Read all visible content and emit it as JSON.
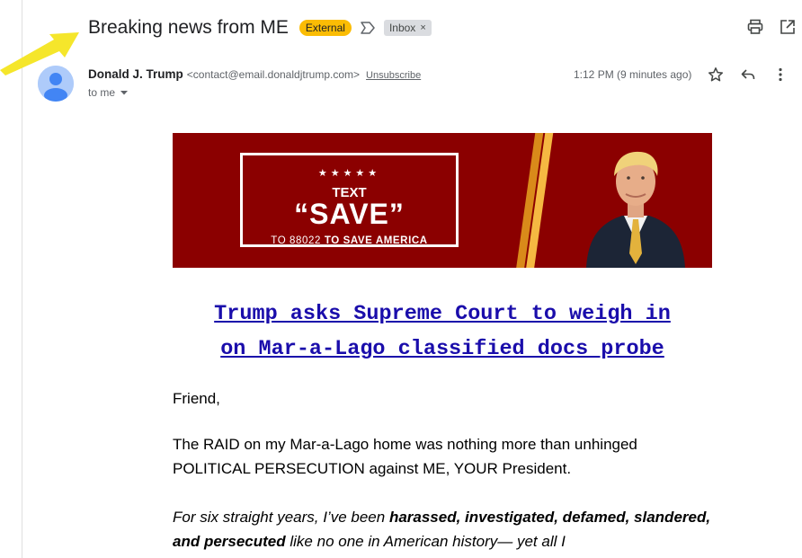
{
  "email": {
    "subject": "Breaking news from ME",
    "labels": {
      "external": "External",
      "inbox": "Inbox",
      "remove_label": "×"
    },
    "sender": {
      "name": "Donald J. Trump",
      "email": "<contact@email.donaldjtrump.com>",
      "unsubscribe": "Unsubscribe"
    },
    "recipient": "to me",
    "time": "1:12 PM (9 minutes ago)"
  },
  "banner": {
    "stars": "★★★★★",
    "line1": "TEXT",
    "line2": "“SAVE”",
    "line3_prefix": "TO 88022 ",
    "line3_bold": "TO SAVE AMERICA"
  },
  "body": {
    "headline_line1": "Trump asks Supreme Court to weigh in",
    "headline_line2": "on Mar-a-Lago classified docs probe",
    "greeting": "Friend,",
    "para1": "The RAID on my Mar-a-Lago home was nothing more than unhinged POLITICAL PERSECUTION against ME, YOUR President.",
    "para2_a": "For six straight years, I’ve been ",
    "para2_b": "harassed, investigated, defamed, slandered, and persecuted",
    "para2_c": " like no one in American history— yet all I"
  },
  "icons": {
    "print": "printer-icon",
    "open_new": "open-in-new-window-icon",
    "star": "star-icon",
    "reply": "reply-icon",
    "more": "more-vertical-icon",
    "label": "label-outline-icon",
    "avatar": "person-avatar-icon",
    "annotation": "yellow-arrow"
  },
  "colors": {
    "external_badge": "#fbbc04",
    "inbox_badge": "#dadce0",
    "banner_bg": "#8b0000",
    "link": "#1a0dab",
    "arrow": "#f5e62b"
  }
}
